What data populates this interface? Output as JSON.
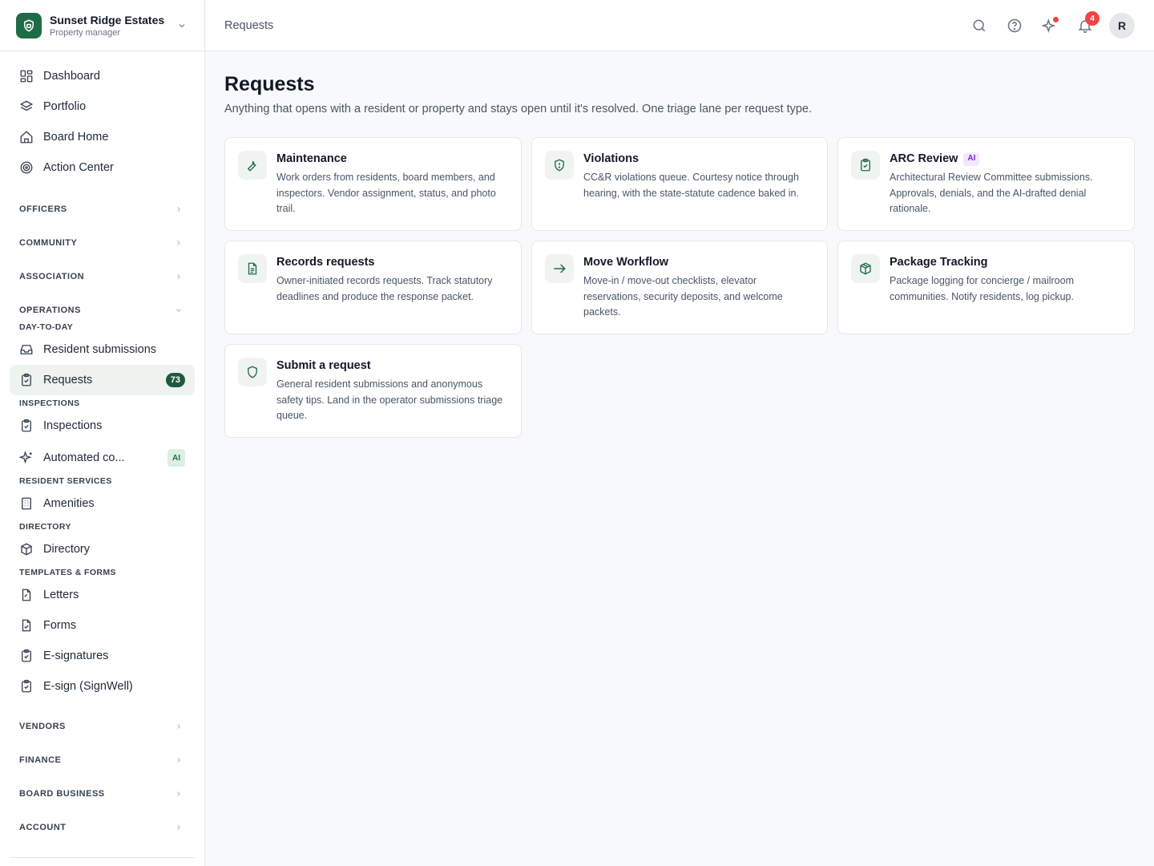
{
  "brand": {
    "name": "Sunset Ridge Estates",
    "role": "Property manager"
  },
  "nav_top": [
    {
      "label": "Dashboard",
      "icon": "dashboard-icon"
    },
    {
      "label": "Portfolio",
      "icon": "layers-icon"
    },
    {
      "label": "Board Home",
      "icon": "home-icon"
    },
    {
      "label": "Action Center",
      "icon": "target-icon"
    }
  ],
  "sections": {
    "officers": "OFFICERS",
    "community": "COMMUNITY",
    "association": "ASSOCIATION",
    "operations": "OPERATIONS",
    "vendors": "VENDORS",
    "finance": "FINANCE",
    "board_business": "BOARD BUSINESS",
    "account": "ACCOUNT"
  },
  "subsections": {
    "day_to_day": "DAY-TO-DAY",
    "inspections": "INSPECTIONS",
    "resident_services": "RESIDENT SERVICES",
    "directory": "DIRECTORY",
    "templates_forms": "TEMPLATES & FORMS"
  },
  "ops_items": {
    "resident_submissions": "Resident submissions",
    "requests": "Requests",
    "requests_count": "73",
    "inspections": "Inspections",
    "automated": "Automated co...",
    "automated_tag": "AI",
    "amenities": "Amenities",
    "directory": "Directory",
    "letters": "Letters",
    "forms": "Forms",
    "esignatures": "E-signatures",
    "esign_signwell": "E-sign (SignWell)"
  },
  "header": {
    "breadcrumb": "Requests",
    "notifications_count": "4",
    "avatar_initial": "R"
  },
  "page": {
    "title": "Requests",
    "subtitle": "Anything that opens with a resident or property and stays open until it's resolved. One triage lane per request type."
  },
  "cards": [
    {
      "title": "Maintenance",
      "icon": "wrench-icon",
      "desc": "Work orders from residents, board members, and inspectors. Vendor assignment, status, and photo trail."
    },
    {
      "title": "Violations",
      "icon": "shield-alert-icon",
      "desc": "CC&R violations queue. Courtesy notice through hearing, with the state-statute cadence baked in."
    },
    {
      "title": "ARC Review",
      "icon": "clipboard-check-icon",
      "tag": "AI",
      "desc": "Architectural Review Committee submissions. Approvals, denials, and the AI-drafted denial rationale."
    },
    {
      "title": "Records requests",
      "icon": "document-icon",
      "desc": "Owner-initiated records requests. Track statutory deadlines and produce the response packet."
    },
    {
      "title": "Move Workflow",
      "icon": "arrow-right-icon",
      "desc": "Move-in / move-out checklists, elevator reservations, security deposits, and welcome packets."
    },
    {
      "title": "Package Tracking",
      "icon": "package-icon",
      "desc": "Package logging for concierge / mailroom communities. Notify residents, log pickup."
    },
    {
      "title": "Submit a request",
      "icon": "shield-icon",
      "desc": "General resident submissions and anonymous safety tips. Land in the operator submissions triage queue."
    }
  ],
  "colors": {
    "accent": "#1f6b47",
    "badge": "#1f5a3d",
    "alert": "#ef4444",
    "ai_tag_bg": "#f3e8ff",
    "ai_tag_fg": "#7e22ce"
  }
}
